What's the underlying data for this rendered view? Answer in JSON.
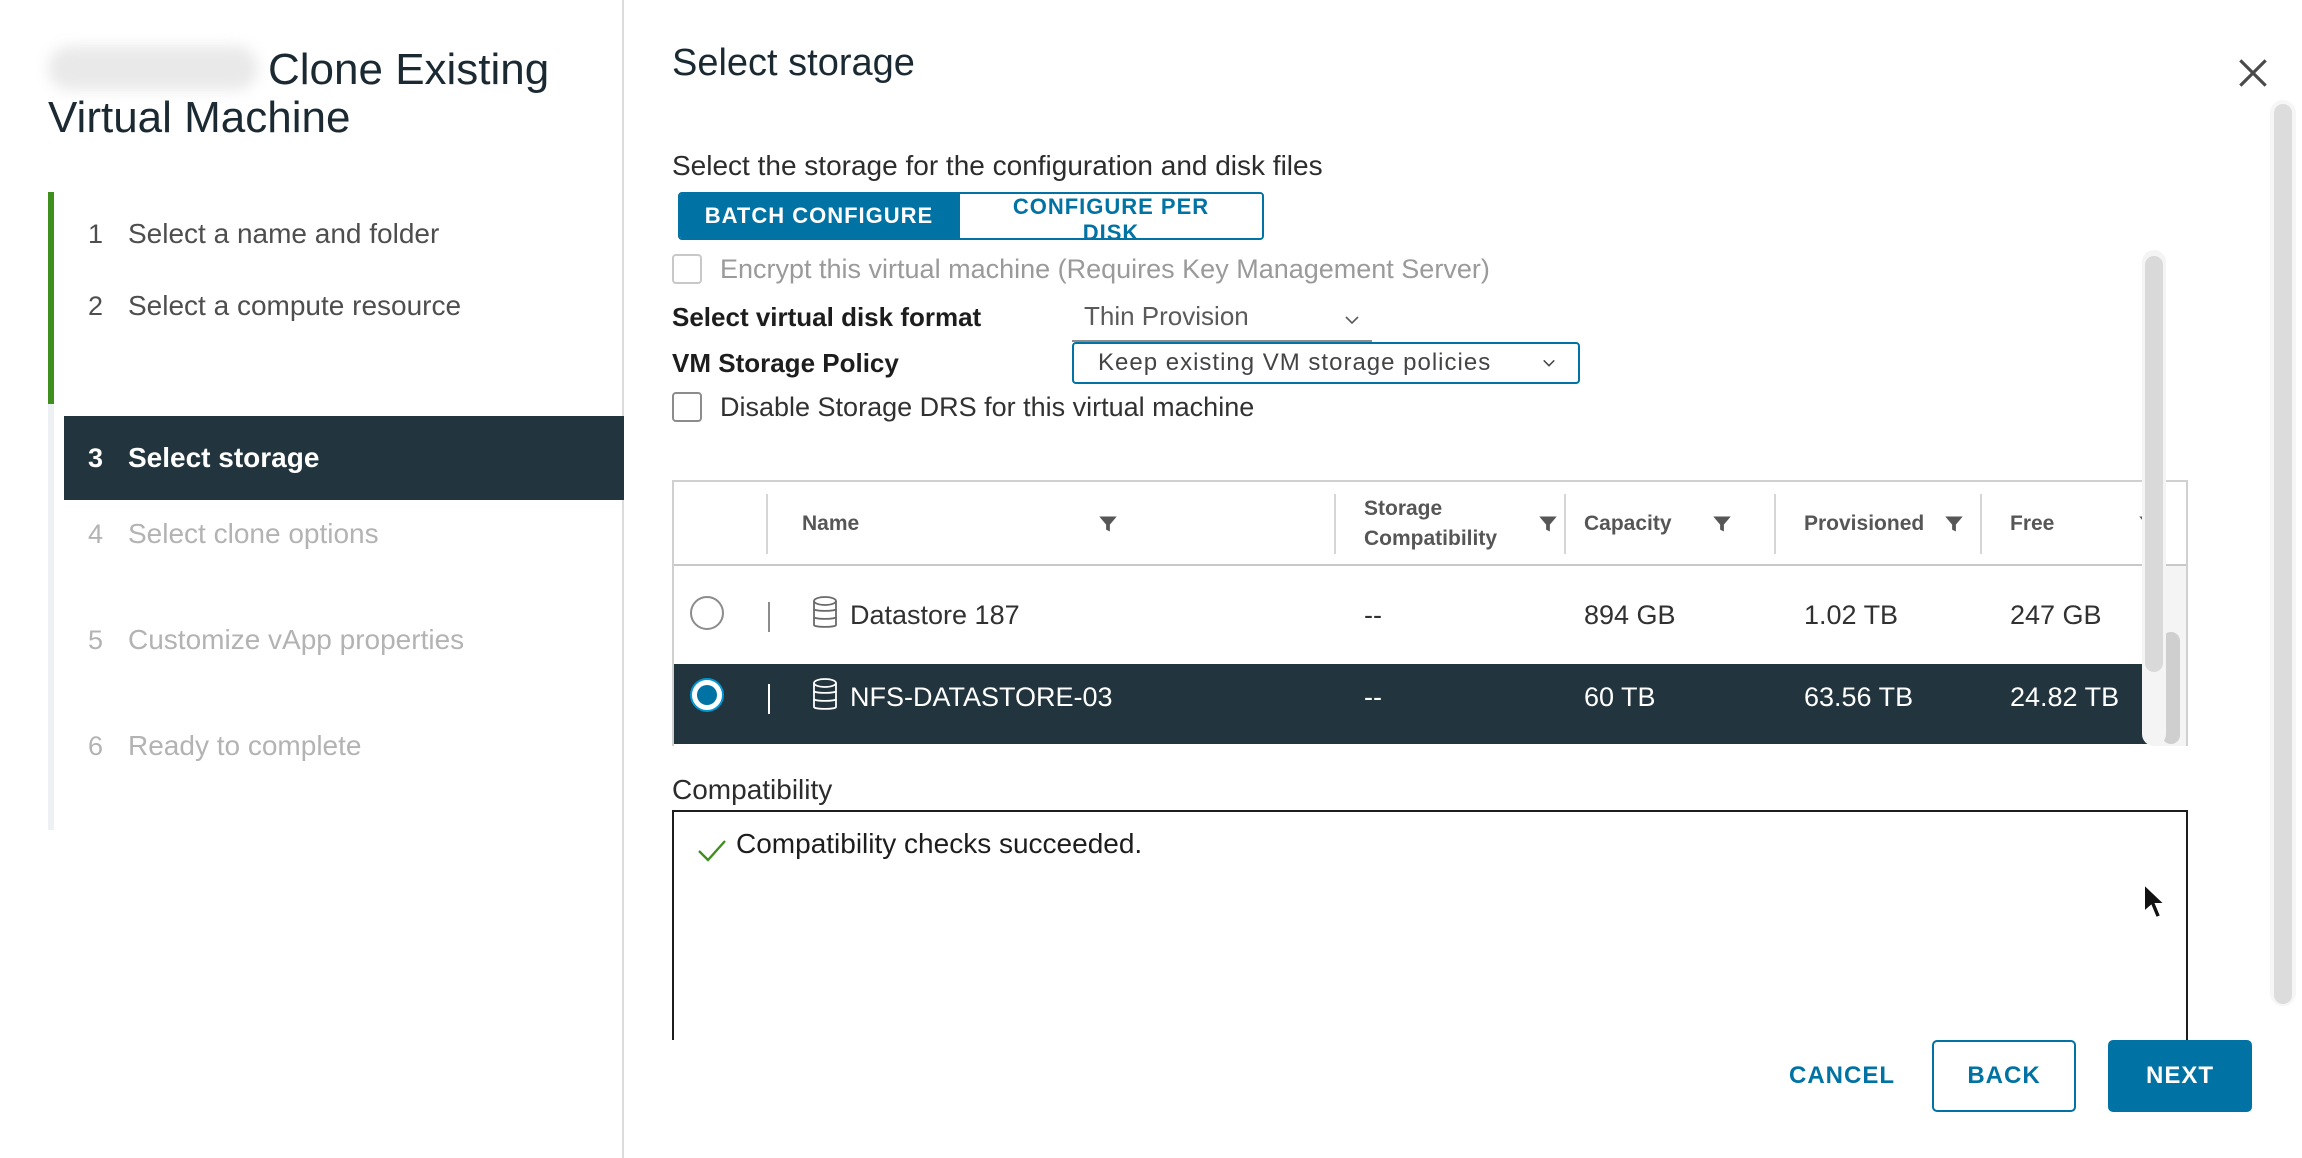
{
  "wizard": {
    "title": "Clone Existing Virtual Machine",
    "steps": [
      {
        "num": "1",
        "label": "Select a name and folder"
      },
      {
        "num": "2",
        "label": "Select a compute resource"
      },
      {
        "num": "3",
        "label": "Select storage"
      },
      {
        "num": "4",
        "label": "Select clone options"
      },
      {
        "num": "5",
        "label": "Customize vApp properties"
      },
      {
        "num": "6",
        "label": "Ready to complete"
      }
    ],
    "active_step": 3
  },
  "page": {
    "title": "Select storage",
    "subtitle": "Select the storage for the configuration and disk files"
  },
  "toggle": {
    "batch_label": "BATCH CONFIGURE",
    "per_disk_label": "CONFIGURE PER DISK"
  },
  "options": {
    "encrypt_label": "Encrypt this virtual machine (Requires Key Management Server)",
    "disk_format_label": "Select virtual disk format",
    "disk_format_value": "Thin Provision",
    "policy_label": "VM Storage Policy",
    "policy_value": "Keep existing VM storage policies",
    "drs_label": "Disable Storage DRS for this virtual machine"
  },
  "grid": {
    "columns": {
      "name": "Name",
      "compat_line1": "Storage",
      "compat_line2": "Compatibility",
      "capacity": "Capacity",
      "provisioned": "Provisioned",
      "free": "Free"
    },
    "rows": [
      {
        "name": "Datastore 187",
        "compat": "--",
        "capacity": "894 GB",
        "provisioned": "1.02 TB",
        "free": "247 GB",
        "selected": false
      },
      {
        "name": "NFS-DATASTORE-03",
        "compat": "--",
        "capacity": "60 TB",
        "provisioned": "63.56 TB",
        "free": "24.82 TB",
        "selected": true
      }
    ]
  },
  "compatibility": {
    "title": "Compatibility",
    "message": "Compatibility checks succeeded."
  },
  "footer": {
    "cancel": "CANCEL",
    "back": "BACK",
    "next": "NEXT"
  },
  "colors": {
    "accent": "#0072a3",
    "active_step_bg": "#22343d",
    "done_step": "#3f8f1f",
    "success_check": "#3f8f1f"
  }
}
